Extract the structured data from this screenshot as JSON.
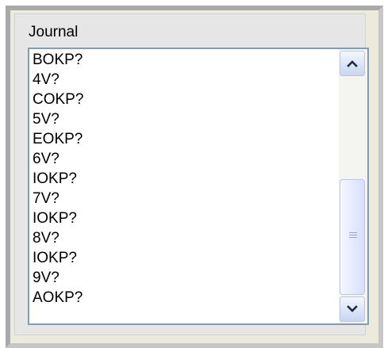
{
  "group": {
    "label": "Journal"
  },
  "journal_list": {
    "items": [
      "BOKP?",
      "4V?",
      "COKP?",
      "5V?",
      "EOKP?",
      "6V?",
      "IOKP?",
      "7V?",
      "IOKP?",
      "8V?",
      "IOKP?",
      "9V?",
      "AOKP?"
    ]
  },
  "scrollbar": {
    "up_icon": "chevron-up-icon",
    "down_icon": "chevron-down-icon",
    "grip_icon": "grip-lines-icon"
  }
}
